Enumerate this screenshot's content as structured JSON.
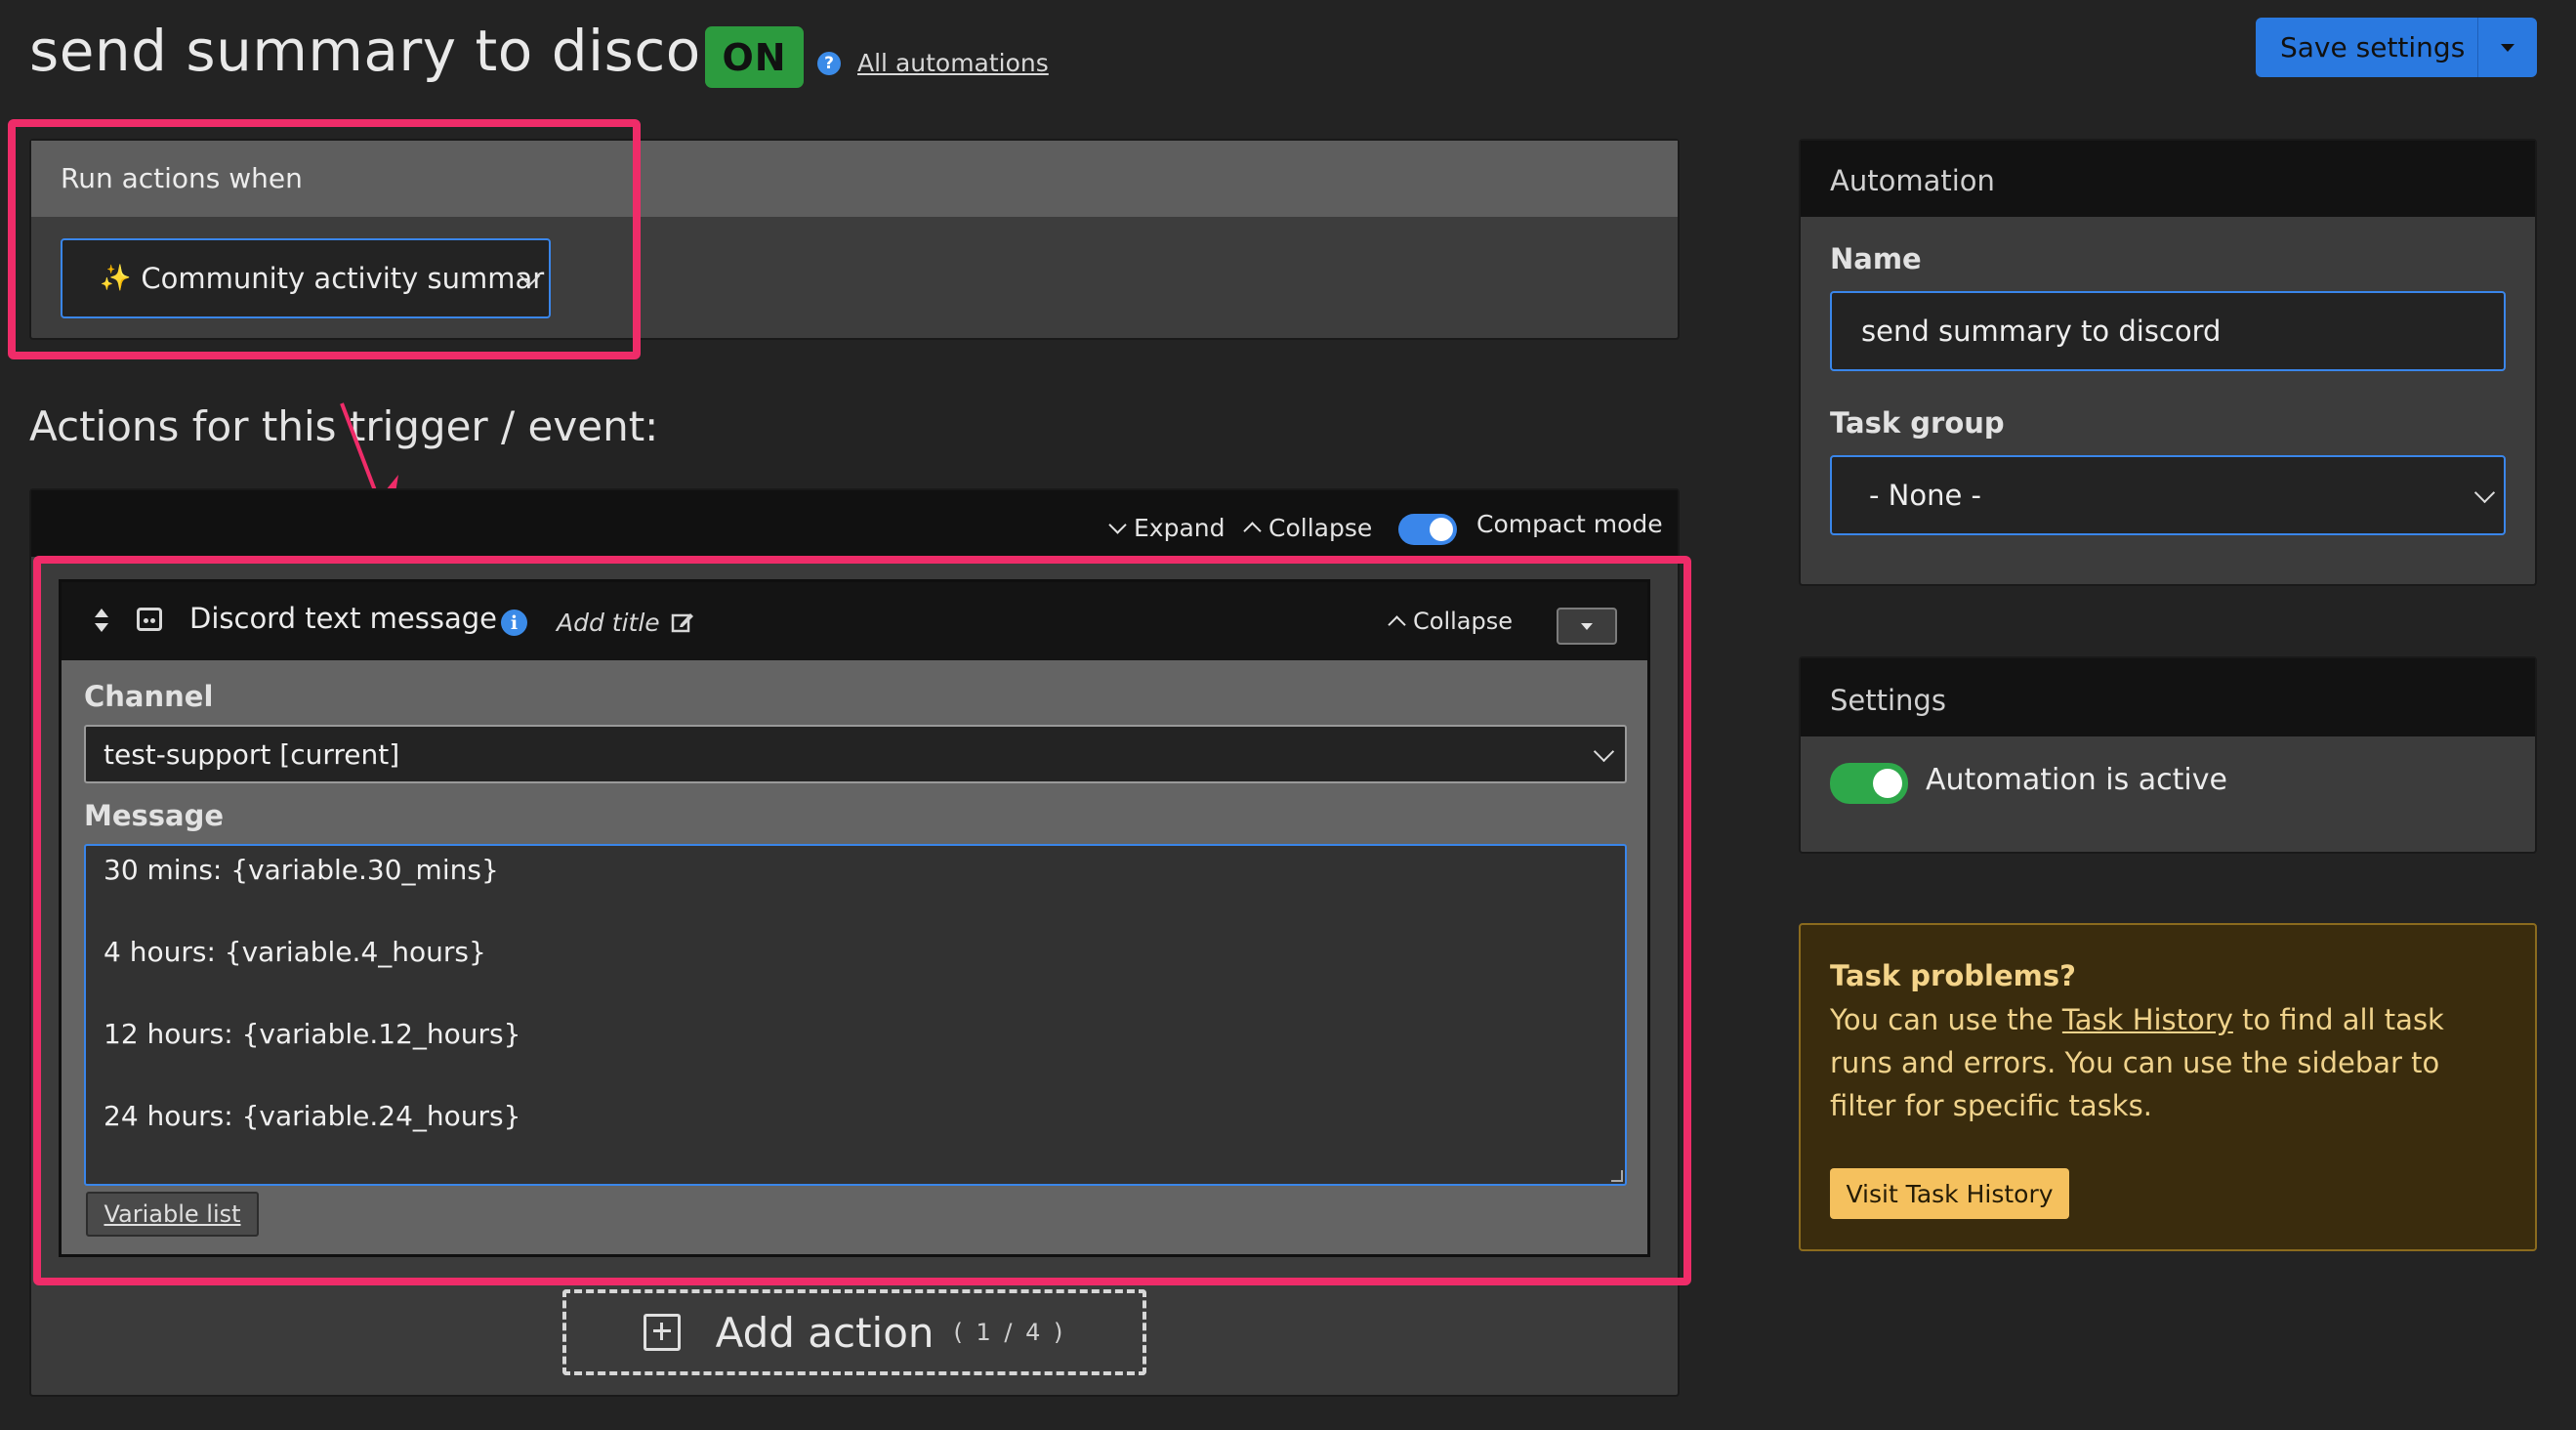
{
  "header": {
    "title": "send summary to discord",
    "status_badge": "ON",
    "help_icon": "?",
    "all_automations_link": "All automations",
    "save_button": "Save settings"
  },
  "trigger": {
    "heading": "Run actions when",
    "selected": "Community activity summar",
    "icon": "sparkles-icon"
  },
  "actions": {
    "heading": "Actions for this trigger / event:",
    "toolbar": {
      "expand": "Expand",
      "collapse": "Collapse",
      "compact_mode": "Compact mode",
      "compact_mode_on": true
    },
    "card": {
      "title": "Discord text message",
      "add_title": "Add title",
      "collapse": "Collapse",
      "channel_label": "Channel",
      "channel_value": "test-support [current]",
      "message_label": "Message",
      "message_lines": [
        "30 mins: {variable.30_mins}",
        "4 hours: {variable.4_hours}",
        "12 hours: {variable.12_hours}",
        "24 hours: {variable.24_hours}"
      ],
      "variable_list": "Variable list"
    },
    "add_action": {
      "label": "Add action",
      "count": "( 1 / 4 )"
    }
  },
  "automation_panel": {
    "heading": "Automation",
    "name_label": "Name",
    "name_value": "send summary to discord",
    "task_group_label": "Task group",
    "task_group_value": "- None -"
  },
  "settings_panel": {
    "heading": "Settings",
    "active_label": "Automation is active",
    "active_on": true
  },
  "task_problems": {
    "title": "Task problems?",
    "text_before": "You can use the ",
    "link": "Task History",
    "text_after": " to find all task runs and errors. You can use the sidebar to filter for specific tasks.",
    "button": "Visit Task History"
  },
  "colors": {
    "accent": "#2a79e0",
    "highlight": "#ef2c69",
    "on_green": "#2c9b3e",
    "warning_bg": "#3a2c0d"
  }
}
